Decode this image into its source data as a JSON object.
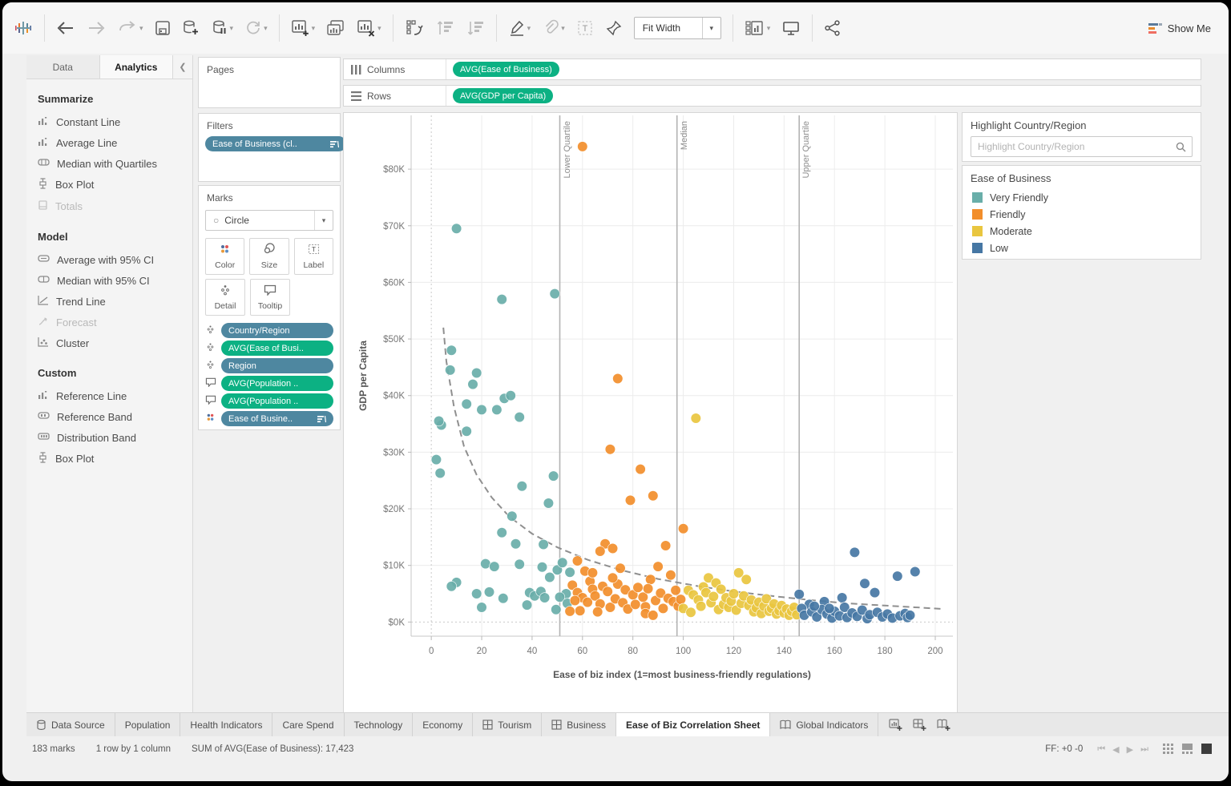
{
  "toolbar": {
    "fit_mode": "Fit Width",
    "show_me_label": "Show Me"
  },
  "sidebar": {
    "tabs": [
      {
        "label": "Data",
        "active": false
      },
      {
        "label": "Analytics",
        "active": true
      }
    ],
    "sections": [
      {
        "title": "Summarize",
        "items": [
          {
            "label": "Constant Line",
            "icon": "constant-line",
            "disabled": false
          },
          {
            "label": "Average Line",
            "icon": "average-line",
            "disabled": false
          },
          {
            "label": "Median with Quartiles",
            "icon": "median-quartiles",
            "disabled": false
          },
          {
            "label": "Box Plot",
            "icon": "box-plot",
            "disabled": false
          },
          {
            "label": "Totals",
            "icon": "totals",
            "disabled": true
          }
        ]
      },
      {
        "title": "Model",
        "items": [
          {
            "label": "Average with 95% CI",
            "icon": "average-ci",
            "disabled": false
          },
          {
            "label": "Median with 95% CI",
            "icon": "median-ci",
            "disabled": false
          },
          {
            "label": "Trend Line",
            "icon": "trend-line",
            "disabled": false
          },
          {
            "label": "Forecast",
            "icon": "forecast",
            "disabled": true
          },
          {
            "label": "Cluster",
            "icon": "cluster",
            "disabled": false
          }
        ]
      },
      {
        "title": "Custom",
        "items": [
          {
            "label": "Reference Line",
            "icon": "reference-line",
            "disabled": false
          },
          {
            "label": "Reference Band",
            "icon": "reference-band",
            "disabled": false
          },
          {
            "label": "Distribution Band",
            "icon": "distribution-band",
            "disabled": false
          },
          {
            "label": "Box Plot",
            "icon": "box-plot",
            "disabled": false
          }
        ]
      }
    ]
  },
  "shelves": {
    "pages_title": "Pages",
    "filters_title": "Filters",
    "filters_pills": [
      {
        "label": "Ease of Business (cl..",
        "color": "blue",
        "sorted": true
      }
    ],
    "marks_title": "Marks",
    "mark_type": "Circle",
    "marks_buttons": [
      {
        "label": "Color",
        "icon": "color"
      },
      {
        "label": "Size",
        "icon": "size"
      },
      {
        "label": "Label",
        "icon": "label"
      },
      {
        "label": "Detail",
        "icon": "detail"
      },
      {
        "label": "Tooltip",
        "icon": "tooltip"
      }
    ],
    "marks_pills": [
      {
        "icon": "detail",
        "label": "Country/Region",
        "color": "blue",
        "sorted": false
      },
      {
        "icon": "detail",
        "label": "AVG(Ease of Busi..",
        "color": "green",
        "sorted": false
      },
      {
        "icon": "detail",
        "label": "Region",
        "color": "blue",
        "sorted": false
      },
      {
        "icon": "tooltip",
        "label": "AVG(Population ..",
        "color": "green",
        "sorted": false
      },
      {
        "icon": "tooltip",
        "label": "AVG(Population ..",
        "color": "green",
        "sorted": false
      },
      {
        "icon": "color",
        "label": "Ease of Busine..",
        "color": "blue",
        "sorted": true
      }
    ],
    "columns_label": "Columns",
    "columns_pills": [
      {
        "label": "AVG(Ease of Business)",
        "color": "green"
      }
    ],
    "rows_label": "Rows",
    "rows_pills": [
      {
        "label": "AVG(GDP per Capita)",
        "color": "green"
      }
    ]
  },
  "highlight_panel": {
    "title": "Highlight Country/Region",
    "placeholder": "Highlight Country/Region"
  },
  "legend": {
    "title": "Ease of Business",
    "items": [
      {
        "label": "Very Friendly",
        "color": "#69aea9"
      },
      {
        "label": "Friendly",
        "color": "#f28e2b"
      },
      {
        "label": "Moderate",
        "color": "#e9c63f"
      },
      {
        "label": "Low",
        "color": "#4677a4"
      }
    ]
  },
  "chart_data": {
    "type": "scatter",
    "xlabel": "Ease of biz index (1=most business-friendly regulations)",
    "ylabel": "GDP per Capita",
    "xlim": [
      -8,
      207
    ],
    "ylim": [
      -2.5,
      89.5
    ],
    "x_ticks": [
      0,
      20,
      40,
      60,
      80,
      100,
      120,
      140,
      160,
      180,
      200
    ],
    "y_ticks": [
      0,
      10,
      20,
      30,
      40,
      50,
      60,
      70,
      80
    ],
    "y_tick_prefix": "$",
    "y_tick_suffix": "K",
    "grid": true,
    "reference_lines": [
      {
        "label": "Lower Quartile",
        "x": 51
      },
      {
        "label": "Median",
        "x": 97.5
      },
      {
        "label": "Upper Quartile",
        "x": 146
      }
    ],
    "trend_line": {
      "style": "dashed",
      "points": [
        [
          4.8,
          52
        ],
        [
          6,
          46
        ],
        [
          9,
          38
        ],
        [
          13,
          31
        ],
        [
          18,
          26
        ],
        [
          24,
          22
        ],
        [
          31,
          18.6
        ],
        [
          40,
          15.6
        ],
        [
          50,
          13.2
        ],
        [
          62,
          11
        ],
        [
          75,
          9.2
        ],
        [
          90,
          7.6
        ],
        [
          105,
          6.4
        ],
        [
          120,
          5.4
        ],
        [
          135,
          4.6
        ],
        [
          150,
          3.9
        ],
        [
          165,
          3.3
        ],
        [
          180,
          2.9
        ],
        [
          196,
          2.5
        ],
        [
          203,
          2.3
        ]
      ]
    },
    "series": [
      {
        "name": "Very Friendly",
        "color": "#69aea9",
        "points": [
          [
            10,
            69.5
          ],
          [
            28,
            57
          ],
          [
            49,
            58
          ],
          [
            8,
            48
          ],
          [
            7.5,
            44.5
          ],
          [
            18,
            44
          ],
          [
            16.5,
            42
          ],
          [
            29,
            39.5
          ],
          [
            31.5,
            40
          ],
          [
            14,
            38.5
          ],
          [
            26,
            37.5
          ],
          [
            20,
            37.5
          ],
          [
            35,
            36.2
          ],
          [
            4,
            34.8
          ],
          [
            3,
            35.5
          ],
          [
            14,
            33.7
          ],
          [
            2,
            28.7
          ],
          [
            3.5,
            26.3
          ],
          [
            48.5,
            25.8
          ],
          [
            36,
            24
          ],
          [
            46.5,
            21
          ],
          [
            32,
            18.7
          ],
          [
            28,
            15.8
          ],
          [
            33.5,
            13.8
          ],
          [
            44.5,
            13.7
          ],
          [
            10,
            7
          ],
          [
            8,
            6.3
          ],
          [
            21.5,
            10.3
          ],
          [
            25,
            9.8
          ],
          [
            35,
            10.2
          ],
          [
            44,
            9.7
          ],
          [
            18,
            5
          ],
          [
            23,
            5.3
          ],
          [
            28.5,
            4.2
          ],
          [
            39,
            5.2
          ],
          [
            41,
            4.6
          ],
          [
            43.5,
            5.4
          ],
          [
            45,
            4.3
          ],
          [
            38,
            3
          ],
          [
            20,
            2.6
          ],
          [
            47,
            7.9
          ],
          [
            50,
            9.2
          ],
          [
            52,
            10.5
          ],
          [
            55,
            8.8
          ],
          [
            53.5,
            5
          ],
          [
            51,
            4.4
          ],
          [
            54,
            3.3
          ],
          [
            49.5,
            2.2
          ]
        ]
      },
      {
        "name": "Friendly",
        "color": "#f28e2b",
        "points": [
          [
            60,
            84
          ],
          [
            74,
            43
          ],
          [
            71,
            30.5
          ],
          [
            83,
            27
          ],
          [
            79,
            21.5
          ],
          [
            88,
            22.3
          ],
          [
            100,
            16.5
          ],
          [
            93,
            13.5
          ],
          [
            69,
            13.8
          ],
          [
            72,
            13
          ],
          [
            67,
            12.5
          ],
          [
            75,
            9.5
          ],
          [
            90,
            9.8
          ],
          [
            95,
            8.3
          ],
          [
            87,
            7.5
          ],
          [
            58,
            10.8
          ],
          [
            61,
            9
          ],
          [
            63,
            7.2
          ],
          [
            56,
            6.5
          ],
          [
            58,
            5.2
          ],
          [
            60,
            4.3
          ],
          [
            62,
            3.5
          ],
          [
            64,
            5.8
          ],
          [
            65,
            4.6
          ],
          [
            67,
            3.2
          ],
          [
            68,
            6.3
          ],
          [
            70,
            5.4
          ],
          [
            71,
            2.6
          ],
          [
            73,
            4.1
          ],
          [
            74,
            6.7
          ],
          [
            76,
            3.4
          ],
          [
            77,
            5.7
          ],
          [
            78,
            2.3
          ],
          [
            80,
            4.8
          ],
          [
            81,
            3.1
          ],
          [
            82,
            6.1
          ],
          [
            84,
            4.4
          ],
          [
            85,
            2.7
          ],
          [
            86,
            5.9
          ],
          [
            89,
            3.8
          ],
          [
            91,
            5.1
          ],
          [
            92,
            2.4
          ],
          [
            94,
            4.2
          ],
          [
            96,
            3.6
          ],
          [
            97,
            5.6
          ],
          [
            98,
            2.8
          ],
          [
            99,
            4.0
          ],
          [
            59,
            2.0
          ],
          [
            57,
            3.8
          ],
          [
            66,
            1.8
          ],
          [
            85,
            1.5
          ],
          [
            88,
            1.2
          ],
          [
            72,
            7.8
          ],
          [
            64,
            8.7
          ],
          [
            55,
            1.9
          ]
        ]
      },
      {
        "name": "Moderate",
        "color": "#e9c63f",
        "points": [
          [
            105,
            36
          ],
          [
            122,
            8.7
          ],
          [
            125,
            7.5
          ],
          [
            110,
            7.8
          ],
          [
            113,
            6.9
          ],
          [
            108,
            6.2
          ],
          [
            102,
            5.6
          ],
          [
            104,
            4.8
          ],
          [
            106,
            3.9
          ],
          [
            107,
            2.8
          ],
          [
            109,
            5.2
          ],
          [
            111,
            3.4
          ],
          [
            112,
            4.5
          ],
          [
            114,
            2.2
          ],
          [
            115,
            5.8
          ],
          [
            116,
            3.1
          ],
          [
            117,
            4.3
          ],
          [
            118,
            2.6
          ],
          [
            119,
            3.7
          ],
          [
            120,
            5.0
          ],
          [
            121,
            2.1
          ],
          [
            123,
            3.3
          ],
          [
            124,
            4.6
          ],
          [
            126,
            2.9
          ],
          [
            127,
            3.9
          ],
          [
            128,
            1.8
          ],
          [
            129,
            2.5
          ],
          [
            130,
            3.5
          ],
          [
            131,
            1.5
          ],
          [
            132,
            2.8
          ],
          [
            133,
            4.1
          ],
          [
            134,
            1.9
          ],
          [
            135,
            2.4
          ],
          [
            136,
            3.2
          ],
          [
            137,
            1.4
          ],
          [
            138,
            2.0
          ],
          [
            139,
            2.9
          ],
          [
            140,
            1.6
          ],
          [
            141,
            2.3
          ],
          [
            142,
            1.2
          ],
          [
            143,
            1.9
          ],
          [
            144,
            2.6
          ],
          [
            145,
            1.3
          ],
          [
            100,
            2.4
          ],
          [
            103,
            1.7
          ]
        ]
      },
      {
        "name": "Low",
        "color": "#4677a4",
        "points": [
          [
            168,
            12.3
          ],
          [
            185,
            8.1
          ],
          [
            192,
            8.9
          ],
          [
            172,
            6.8
          ],
          [
            176,
            5.2
          ],
          [
            163,
            4.3
          ],
          [
            156,
            3.6
          ],
          [
            150,
            3.1
          ],
          [
            147,
            2.4
          ],
          [
            148,
            1.2
          ],
          [
            151,
            1.8
          ],
          [
            153,
            0.9
          ],
          [
            155,
            2.2
          ],
          [
            157,
            1.4
          ],
          [
            159,
            0.7
          ],
          [
            160,
            1.9
          ],
          [
            162,
            1.1
          ],
          [
            164,
            2.6
          ],
          [
            165,
            0.8
          ],
          [
            167,
            1.6
          ],
          [
            169,
            1.0
          ],
          [
            171,
            2.1
          ],
          [
            173,
            0.6
          ],
          [
            174,
            1.3
          ],
          [
            177,
            1.7
          ],
          [
            179,
            0.9
          ],
          [
            181,
            1.4
          ],
          [
            183,
            0.7
          ],
          [
            186,
            1.1
          ],
          [
            188,
            1.5
          ],
          [
            189,
            0.8
          ],
          [
            190,
            1.2
          ],
          [
            146,
            4.9
          ],
          [
            152,
            2.8
          ],
          [
            158,
            2.4
          ]
        ]
      }
    ]
  },
  "sheet_tabs": {
    "tabs": [
      {
        "label": "Data Source",
        "icon": "datasource",
        "active": false
      },
      {
        "label": "Population",
        "icon": null,
        "active": false
      },
      {
        "label": "Health Indicators",
        "icon": null,
        "active": false
      },
      {
        "label": "Care Spend",
        "icon": null,
        "active": false
      },
      {
        "label": "Technology",
        "icon": null,
        "active": false
      },
      {
        "label": "Economy",
        "icon": null,
        "active": false
      },
      {
        "label": "Tourism",
        "icon": "grid",
        "active": false
      },
      {
        "label": "Business",
        "icon": "grid",
        "active": false
      },
      {
        "label": "Ease of Biz Correlation Sheet",
        "icon": null,
        "active": true
      },
      {
        "label": "Global Indicators",
        "icon": "story",
        "active": false
      }
    ]
  },
  "status_bar": {
    "marks": "183 marks",
    "layout": "1 row by 1 column",
    "aggregate": "SUM of AVG(Ease of Business): 17,423",
    "ff": "FF: +0 -0"
  }
}
